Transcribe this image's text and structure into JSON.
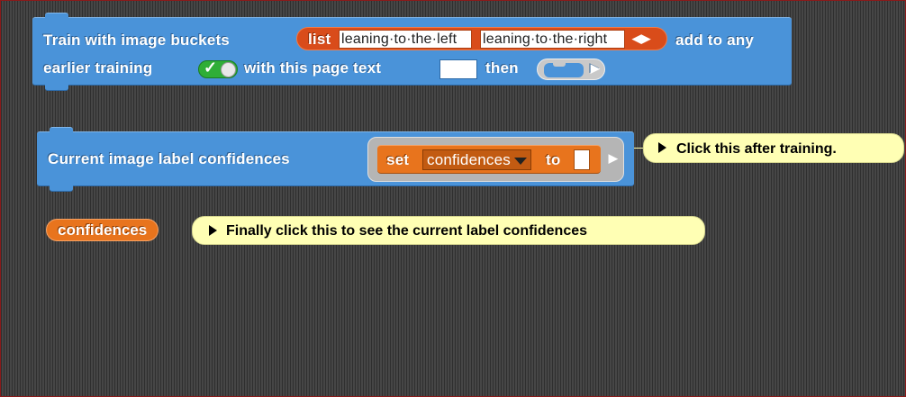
{
  "train_block": {
    "line1_prefix": "Train with image buckets",
    "list_keyword": "list",
    "list_items": [
      "leaning·to·the·left",
      "leaning·to·the·right"
    ],
    "line1_suffix": "add to any",
    "line2_prefix": "earlier training",
    "toggle_checked": true,
    "line2_middle": "with this page text",
    "page_text_value": "",
    "line2_then": "then"
  },
  "confidence_block": {
    "label": "Current image label confidences",
    "set_keyword": "set",
    "variable": "confidences",
    "to_keyword": "to",
    "set_value": ""
  },
  "confidences_reporter": {
    "label": "confidences"
  },
  "comments": {
    "after_training": "Click this after training.",
    "finally_click": "Finally click this to see the current label confidences"
  },
  "colors": {
    "motion_blue": "#4a93d9",
    "list_red": "#d94c1a",
    "variable_orange": "#e8741d",
    "comment_yellow": "#ffffb4",
    "toggle_green": "#2fae37"
  },
  "icons": {
    "list_arrows": "left-right-arrows-icon",
    "ring_arrow": "right-arrow-icon",
    "comment_collapse": "triangle-right-icon",
    "dropdown": "dropdown-triangle-icon",
    "toggle_check": "check-icon"
  }
}
